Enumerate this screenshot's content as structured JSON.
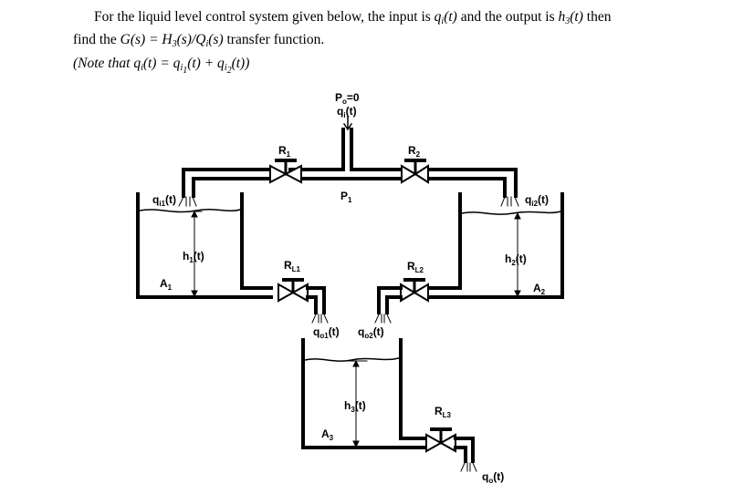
{
  "problem": {
    "line1_prefix": "For the liquid level control system given below, the input is",
    "line1_input": "q",
    "line1_input_sub": "i",
    "line1_input_arg": "(t)",
    "line1_mid": "and the output is",
    "line1_output": "h",
    "line1_output_sub": "3",
    "line1_output_arg": "(t)",
    "line1_suffix": "then",
    "line2_prefix": "find the",
    "line2_formula": "G(s) = H",
    "line2_formula_sub": "3",
    "line2_formula_rest": "(s)/Q",
    "line2_formula_sub2": "i",
    "line2_formula_end": "(s)",
    "line2_suffix": "transfer function.",
    "line3_note": "(Note that",
    "line3_formula": "q",
    "line3_sub_i": "i",
    "line3_eq": "(t) = q",
    "line3_sub_i1": "i",
    "line3_sub_1": "1",
    "line3_plus": "(t) + q",
    "line3_sub_i2": "i",
    "line3_sub_2": "2",
    "line3_end": "(t))"
  },
  "diagram": {
    "source": {
      "pressure": "P",
      "pressure_sub": "o",
      "pressure_val": "=0",
      "flow": "q",
      "flow_sub": "i",
      "flow_arg": "(t)"
    },
    "junction_pressure": {
      "main": "P",
      "sub": "1"
    },
    "valves": {
      "r1": {
        "main": "R",
        "sub": "1"
      },
      "r2": {
        "main": "R",
        "sub": "2"
      },
      "rl1": {
        "main": "R",
        "sub": "L1"
      },
      "rl2": {
        "main": "R",
        "sub": "L2"
      },
      "rl3": {
        "main": "R",
        "sub": "L3"
      }
    },
    "tanks": {
      "tank1": {
        "inflow": "q",
        "inflow_sub": "i1",
        "inflow_arg": "(t)",
        "level": "h",
        "level_sub": "1",
        "level_arg": "(t)",
        "area": "A",
        "area_sub": "1"
      },
      "tank2": {
        "inflow": "q",
        "inflow_sub": "i2",
        "inflow_arg": "(t)",
        "level": "h",
        "level_sub": "2",
        "level_arg": "(t)",
        "area": "A",
        "area_sub": "2"
      },
      "tank3": {
        "level": "h",
        "level_sub": "3",
        "level_arg": "(t)",
        "area": "A",
        "area_sub": "3"
      }
    },
    "outflows": {
      "qo1": {
        "main": "q",
        "sub": "o1",
        "arg": "(t)"
      },
      "qo2": {
        "main": "q",
        "sub": "o2",
        "arg": "(t)"
      },
      "qo": {
        "main": "q",
        "sub": "o",
        "arg": "(t)"
      }
    }
  }
}
